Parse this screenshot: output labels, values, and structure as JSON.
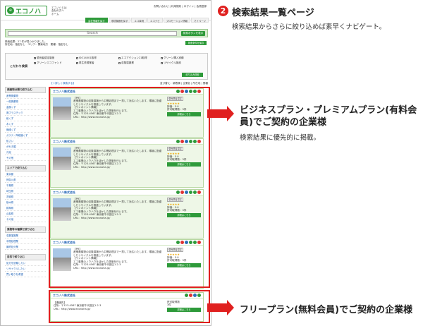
{
  "site": {
    "logo_text": "エコノハ",
    "logo_mark": "e",
    "header_links": [
      "エコノハとは",
      "会社の方へ",
      "ホーム"
    ],
    "header_right": "お問い合わせ | 利用規約 | ログイン | 会員登録",
    "nav": [
      {
        "label": "会社情報を探す",
        "active": true
      },
      {
        "label": "環境機器を探す",
        "active": false
      },
      {
        "label": "エコ事例",
        "active": false
      },
      {
        "label": "エコナビ",
        "active": false
      },
      {
        "label": "プロモーション情報",
        "active": false
      },
      {
        "label": "マイページ",
        "active": false
      }
    ]
  },
  "search": {
    "placeholder": "Search",
    "button": "検索ボタンを表示"
  },
  "meta": {
    "line1": "検索結果：27 件が見つかりました。",
    "line2": "所在地：指定なし　エリア：関東地方　業種：指定なし",
    "button": "検索条件を保存"
  },
  "kodawari": {
    "title": "こだわり検索",
    "options": [
      "優良者認定制度",
      "ISO14001取得",
      "エコアクション21取得",
      "グリーン購入実績",
      "グリーンエコファンド",
      "再生資源業者",
      "収集運搬業",
      "リサイクル施設"
    ],
    "button": "絞り込み検索"
  },
  "sidebar": [
    {
      "heading": "廃棄物分類で絞り込む",
      "items": [
        "産業廃棄物",
        "一般廃棄物",
        "金属くず",
        "廃プラスチック",
        "紙くず",
        "木くず",
        "繊維くず",
        "ガラス・陶磁器くず",
        "鉱さい",
        "がれき類",
        "汚泥",
        "その他"
      ]
    },
    {
      "heading": "エリアで絞り込む",
      "items": [
        "東京都",
        "神奈川県",
        "千葉県",
        "埼玉県",
        "茨城県",
        "栃木県",
        "群馬県",
        "山梨県",
        "その他"
      ]
    },
    {
      "heading": "業務等の種類で絞り込む",
      "items": [
        "収集運搬業",
        "中間処理業",
        "最終処分業"
      ]
    },
    {
      "heading": "目的で絞り込む",
      "items": [
        "処分を依頼したい",
        "リサイクルしたい",
        "買い取りを希望"
      ]
    }
  ],
  "results": {
    "sort_left": "【＞詳しく検索する】",
    "sort_right": "並び替え：新着順 | 企業名 | 所在地 | 業種",
    "cards": [
      {
        "premium": true,
        "name": "エコノハ株式会社",
        "pr": "【PR】",
        "desc": "産業廃棄物の収集運搬から中間処理まで一貫して対応いたします。環境に配慮したリサイクルを推進しています。",
        "point": "【ワンポイント情報】",
        "note": "エコ事業のノウハウを活かした提案を行います。",
        "addr": "住所：〒123-4567 東京都千代田区1-2-3",
        "url": "URL：http://www.econoha.jp/",
        "r1": "優良業者認定",
        "r2": "評価：5.0",
        "r3": "許可取得数：3件",
        "btn": "詳細はこちら"
      },
      {
        "premium": true,
        "name": "エコノハ株式会社",
        "pr": "【PR】",
        "desc": "産業廃棄物の収集運搬から中間処理まで一貫して対応いたします。環境に配慮したリサイクルを推進しています。",
        "point": "【ワンポイント情報】",
        "note": "エコ事業のノウハウを活かした提案を行います。",
        "addr": "住所：〒123-4567 東京都千代田区1-2-3",
        "url": "URL：http://www.econoha.jp/",
        "r1": "優良業者認定",
        "r2": "評価：5.0",
        "r3": "許可取得数：3件",
        "btn": "詳細はこちら"
      },
      {
        "premium": true,
        "name": "エコノハ株式会社",
        "pr": "【PR】",
        "desc": "産業廃棄物の収集運搬から中間処理まで一貫して対応いたします。環境に配慮したリサイクルを推進しています。",
        "point": "【ワンポイント情報】",
        "note": "エコ事業のノウハウを活かした提案を行います。",
        "addr": "住所：〒123-4567 東京都千代田区1-2-3",
        "url": "URL：http://www.econoha.jp/",
        "r1": "優良業者認定",
        "r2": "評価：5.0",
        "r3": "許可取得数：3件",
        "btn": "詳細はこちら"
      },
      {
        "premium": false,
        "name": "エコノハ株式会社",
        "pr": "【PR】",
        "desc": "産業廃棄物の収集運搬から中間処理まで一貫して対応いたします。環境に配慮したリサイクルを推進しています。",
        "point": "【ワンポイント情報】",
        "note": "エコ事業のノウハウを活かした提案を行います。",
        "addr": "住所：〒123-4567 東京都千代田区1-2-3",
        "url": "URL：http://www.econoha.jp/",
        "r1": "優良業者認定",
        "r2": "評価：5.0",
        "r3": "許可取得数：3件",
        "btn": "詳細はこちら"
      }
    ],
    "free_card": {
      "name": "エコノハ株式会社",
      "label": "【連絡先】",
      "addr": "住所：〒123-4567 東京都千代田区1-2-3",
      "url": "URL：http://www.econoha.jp/",
      "r1": "許可取得数",
      "r2": "3件",
      "btn": "詳細はこちら"
    }
  },
  "annotations": {
    "number": "2",
    "title": "検索結果一覧ページ",
    "subtitle": "検索結果からさらに絞り込めば素早くナビゲート。",
    "premium_title": "ビジネスプラン・プレミアムプラン(有料会員)でご契約の企業様",
    "premium_sub": "検索結果に優先的に掲載。",
    "free_title": "フリープラン(無料会員)でご契約の企業様"
  },
  "colors": {
    "accent_green": "#2e9a3a",
    "highlight_red": "#e0201f",
    "premium_bg": "#eef7e7"
  }
}
